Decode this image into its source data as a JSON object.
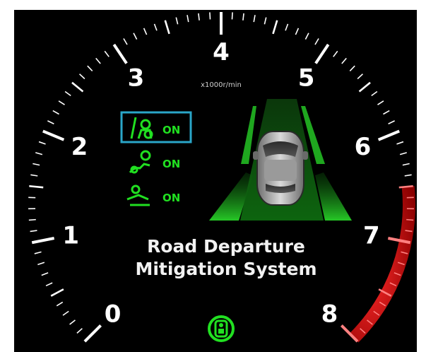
{
  "gauge": {
    "unit_label": "x1000r/min",
    "scale_numbers": [
      "0",
      "1",
      "2",
      "3",
      "4",
      "5",
      "6",
      "7",
      "8"
    ],
    "redline_start": 6.5,
    "redline_end": 8
  },
  "system_status": [
    {
      "icon": "lane-keep-assist-icon",
      "value": "ON",
      "selected": true
    },
    {
      "icon": "steering-wheel-icon",
      "value": "ON",
      "selected": false
    },
    {
      "icon": "seat-vibration-icon",
      "value": "ON",
      "selected": false
    }
  ],
  "caption": {
    "line1": "Road Departure",
    "line2": "Mitigation System"
  },
  "colors": {
    "background": "#000000",
    "status_green": "#21e021",
    "highlight_cyan": "#2aa6c8",
    "redline": "#e0151b",
    "lane_green": "#1fb81f"
  },
  "bottom_indicator": {
    "icon": "seatbelt-indicator-icon"
  }
}
